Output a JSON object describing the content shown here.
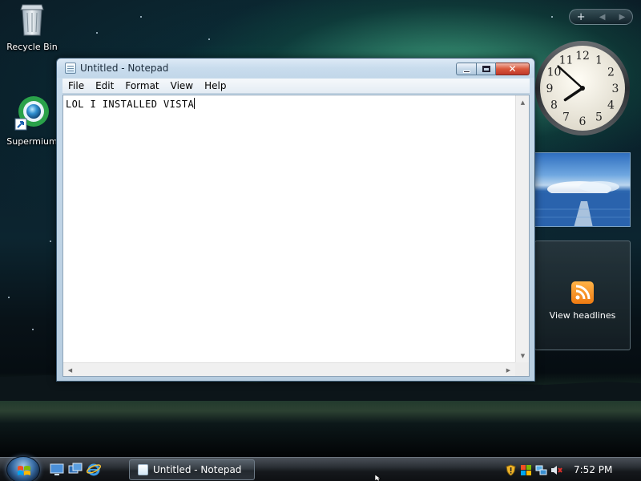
{
  "desktop": {
    "icons": [
      {
        "label": "Recycle Bin",
        "icon": "recycle-bin-icon"
      },
      {
        "label": "Supermium",
        "icon": "supermium-browser-icon"
      }
    ]
  },
  "gadgets": {
    "controls": {
      "add": "+",
      "prev": "◀",
      "next": "▶"
    },
    "clock": {
      "numerals": [
        "12",
        "1",
        "2",
        "3",
        "4",
        "5",
        "6",
        "7",
        "8",
        "9",
        "10",
        "11"
      ],
      "hour": 7,
      "minute": 52
    },
    "slideshow": {
      "icon": "landscape-photo-icon"
    },
    "feed": {
      "label": "View headlines",
      "icon": "rss-feed-icon"
    }
  },
  "notepad": {
    "title": "Untitled - Notepad",
    "menu": [
      "File",
      "Edit",
      "Format",
      "View",
      "Help"
    ],
    "content": "LOL I INSTALLED VISTA",
    "buttons": {
      "minimize": "minimize-icon",
      "maximize": "maximize-icon",
      "close": "✕"
    }
  },
  "taskbar": {
    "start": {
      "icon": "windows-logo-icon"
    },
    "quick_launch": [
      "show-desktop-icon",
      "switch-windows-icon",
      "internet-explorer-icon"
    ],
    "tasks": [
      {
        "label": "Untitled - Notepad",
        "icon": "notepad-icon"
      }
    ],
    "tray_icons": [
      "security-shield-icon",
      "windows-update-icon",
      "network-icon",
      "volume-muted-icon"
    ],
    "clock": "7:52 PM"
  },
  "colors": {
    "accent": "#3a6fa8",
    "close_button": "#c0392b",
    "rss": "#f07b12"
  }
}
